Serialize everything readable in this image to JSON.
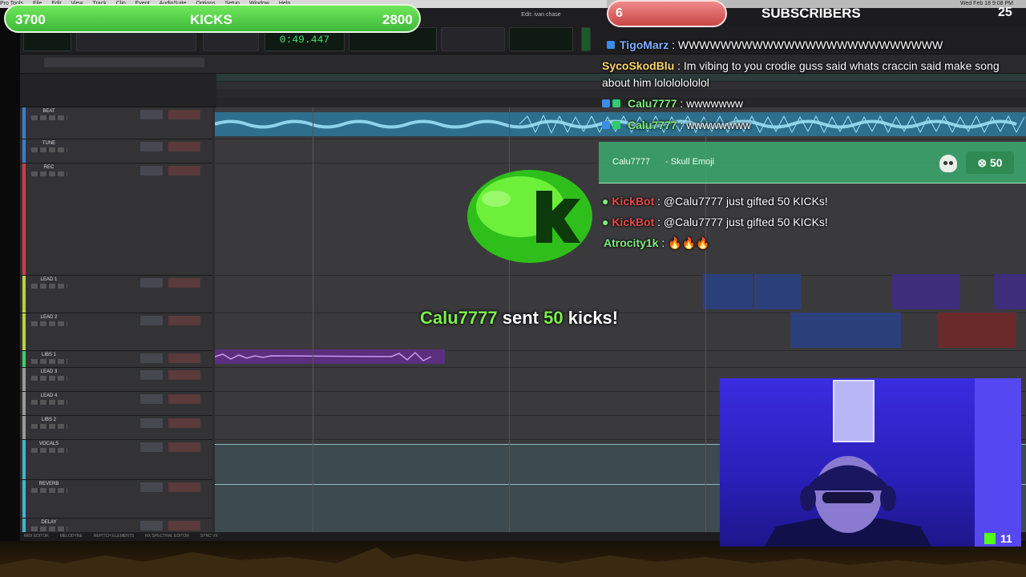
{
  "menubar": {
    "items": [
      "Pro Tools",
      "File",
      "Edit",
      "View",
      "Track",
      "Clip",
      "Event",
      "AudioSuite",
      "Options",
      "Setup",
      "Window",
      "Help"
    ],
    "clock": "Wed Feb 18 9:08 PM"
  },
  "transport": {
    "counter": "0:49.447",
    "edit_title": "Edit: ivan chase"
  },
  "tracks": [
    {
      "name": "BEAT",
      "color": "#3a7dd1"
    },
    {
      "name": "TUNE",
      "color": "#3a7dd1"
    },
    {
      "name": "REC",
      "color": "#d23a48"
    },
    {
      "name": "LEAD 1",
      "color": "#b8d23a"
    },
    {
      "name": "LEAD 2",
      "color": "#b8d23a"
    },
    {
      "name": "LIBS 1",
      "color": "#3ad26a"
    },
    {
      "name": "LEAD 3",
      "color": "#9a9a9a"
    },
    {
      "name": "LEAD 4",
      "color": "#9a9a9a"
    },
    {
      "name": "LIBS 2",
      "color": "#9a9a9a"
    },
    {
      "name": "VOCALS",
      "color": "#3ab8d2"
    },
    {
      "name": "REVERB",
      "color": "#3ab8d2"
    },
    {
      "name": "DELAY",
      "color": "#3ab8d2"
    }
  ],
  "bottom_bar": {
    "items": [
      "MIDI EDITOR",
      "MELODYNE",
      "REPITCH ELEMENTS",
      "RX SPECTRAL EDITOR",
      "SYNC VX"
    ]
  },
  "kicks_bar": {
    "left": "3700",
    "label": "KICKS",
    "right": "2800",
    "colors": {
      "fill": "#4fca40",
      "border": "#e8f8e0"
    }
  },
  "subscribers_bar": {
    "count": "6",
    "label": "SUBSCRIBERS",
    "goal": "25",
    "colors": {
      "fill": "#d95555"
    }
  },
  "chat": [
    {
      "user": "TigoMarz",
      "user_color": "#7fb2ff",
      "text": " : WWWWWWWWWWWWWWWWWWWWWWWWW"
    },
    {
      "user": "SycoSkodBlu",
      "user_color": "#fcd86a",
      "text": " : Im vibing to you crodie guss said whats craccin said make song"
    },
    {
      "user": "",
      "user_color": "#ffffff",
      "text": "about him lolololololol"
    },
    {
      "user": "Calu7777",
      "user_color": "#7ff07f",
      "text": " : wwwwwww"
    },
    {
      "user": "Calu7777",
      "user_color": "#7ff07f",
      "text": " : wwwwwwww"
    }
  ],
  "skull_card": {
    "user": "Calu7777",
    "emoji_label": "- Skull Emoji",
    "amount": "50",
    "icon": "skull-icon"
  },
  "chat_after": [
    {
      "user": "KickBot",
      "user_color": "#e54b4b",
      "text": " : @Calu7777 just gifted 50 KICKs!"
    },
    {
      "user": "KickBot",
      "user_color": "#e54b4b",
      "text": " : @Calu7777 just gifted 50 KICKs!"
    },
    {
      "user": "Atrocity1k",
      "user_color": "#7ff07f",
      "text": " : 🔥🔥🔥"
    }
  ],
  "alert": {
    "user": "Calu7777",
    "verb": "sent",
    "amount": "50",
    "unit": "kicks!"
  },
  "webcam": {
    "viewer_count": "11"
  }
}
